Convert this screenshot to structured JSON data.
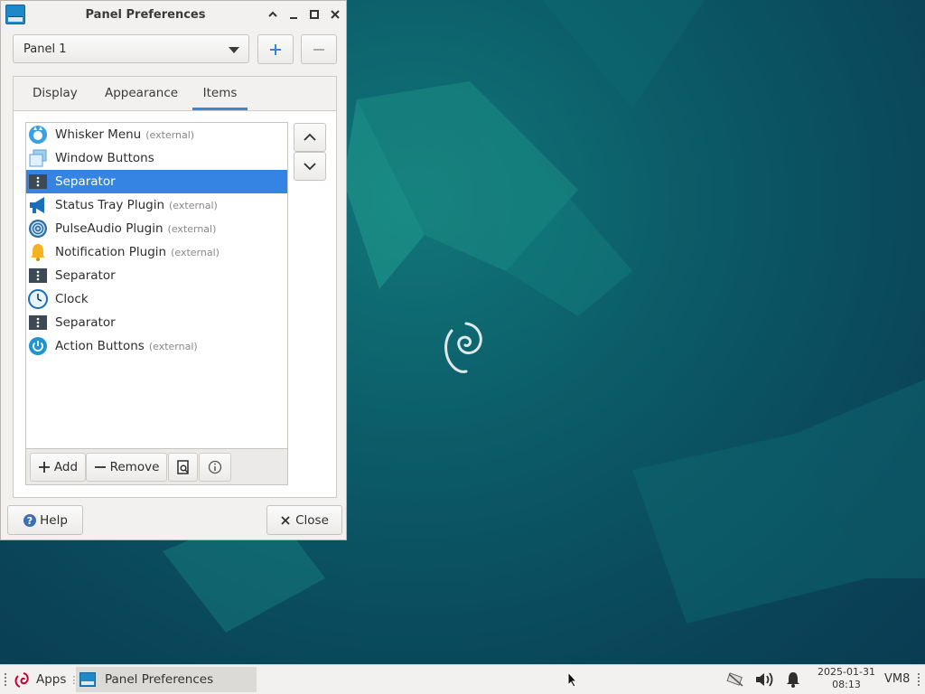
{
  "window": {
    "title": "Panel Preferences",
    "panel_select": {
      "value": "Panel 1"
    },
    "tabs": [
      {
        "label": "Display",
        "active": false
      },
      {
        "label": "Appearance",
        "active": false
      },
      {
        "label": "Items",
        "active": true
      }
    ],
    "items": [
      {
        "name": "Whisker Menu",
        "ext": "(external)",
        "icon": "whisker-menu-icon",
        "selected": false
      },
      {
        "name": "Window Buttons",
        "ext": "",
        "icon": "window-buttons-icon",
        "selected": false
      },
      {
        "name": "Separator",
        "ext": "",
        "icon": "separator-icon",
        "selected": true
      },
      {
        "name": "Status Tray Plugin",
        "ext": "(external)",
        "icon": "megaphone-icon",
        "selected": false
      },
      {
        "name": "PulseAudio Plugin",
        "ext": "(external)",
        "icon": "audio-icon",
        "selected": false
      },
      {
        "name": "Notification Plugin",
        "ext": "(external)",
        "icon": "bell-icon",
        "selected": false
      },
      {
        "name": "Separator",
        "ext": "",
        "icon": "separator-icon",
        "selected": false
      },
      {
        "name": "Clock",
        "ext": "",
        "icon": "clock-icon",
        "selected": false
      },
      {
        "name": "Separator",
        "ext": "",
        "icon": "separator-icon",
        "selected": false
      },
      {
        "name": "Action Buttons",
        "ext": "(external)",
        "icon": "power-icon",
        "selected": false
      }
    ],
    "list_buttons": {
      "add": "Add",
      "remove": "Remove"
    },
    "help_label": "Help",
    "close_label": "Close"
  },
  "taskbar": {
    "apps_label": "Apps",
    "task_label": "Panel Preferences",
    "date": "2025-01-31",
    "time": "08:13",
    "host": "VM8"
  },
  "colors": {
    "selection": "#3584e4",
    "tab_underline": "#3a87d6",
    "desktop": "#0b5a67"
  }
}
